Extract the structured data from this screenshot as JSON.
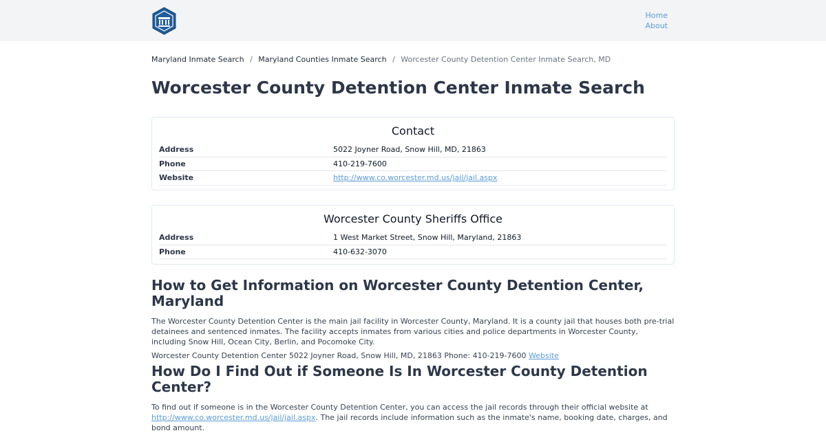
{
  "header": {
    "logo_alt": "site logo",
    "nav": [
      "Home",
      "About"
    ]
  },
  "breadcrumb": {
    "items": [
      "Maryland Inmate Search",
      "Maryland Counties Inmate Search"
    ],
    "separator": "/",
    "current": "Worcester County Detention Center Inmate Search, MD"
  },
  "title": "Worcester County Detention Center Inmate Search",
  "contact": {
    "heading": "Contact",
    "rows": [
      {
        "label": "Address",
        "value": "5022 Joyner Road, Snow Hill, MD, 21863"
      },
      {
        "label": "Phone",
        "value": "410-219-7600"
      },
      {
        "label": "Website",
        "value": "http://www.co.worcester.md.us/jail/jail.aspx"
      }
    ]
  },
  "sheriff": {
    "heading": "Worcester County Sheriffs Office",
    "rows": [
      {
        "label": "Address",
        "value": "1 West Market Street, Snow Hill, Maryland, 21863"
      },
      {
        "label": "Phone",
        "value": "410-632-3070"
      }
    ]
  },
  "section1": {
    "heading": "How to Get Information on Worcester County Detention Center, Maryland",
    "para": "The Worcester County Detention Center is the main jail facility in Worcester County, Maryland. It is a county jail that houses both pre-trial detainees and sentenced inmates. The facility accepts inmates from various cities and police departments in Worcester County, including Snow Hill, Ocean City, Berlin, and Pocomoke City.",
    "info_line": "Worcester County Detention Center 5022 Joyner Road, Snow Hill, MD, 21863 Phone: 410-219-7600",
    "info_link": "Website"
  },
  "section2": {
    "heading": "How Do I Find Out if Someone Is In Worcester County Detention Center?",
    "para_start": "To find out if someone is in the Worcester County Detention Center, you can access the jail records through their official website at",
    "para_link": "http://www.co.worcester.md.us/jail/jail.aspx",
    "para_end": ". The jail records include information such as the inmate's name, booking date, charges, and bond amount."
  },
  "colors": {
    "link": "#5b9bd5",
    "heading": "#2d3748",
    "topbar": "#f3f4f6",
    "logo": "#1f5c99"
  }
}
